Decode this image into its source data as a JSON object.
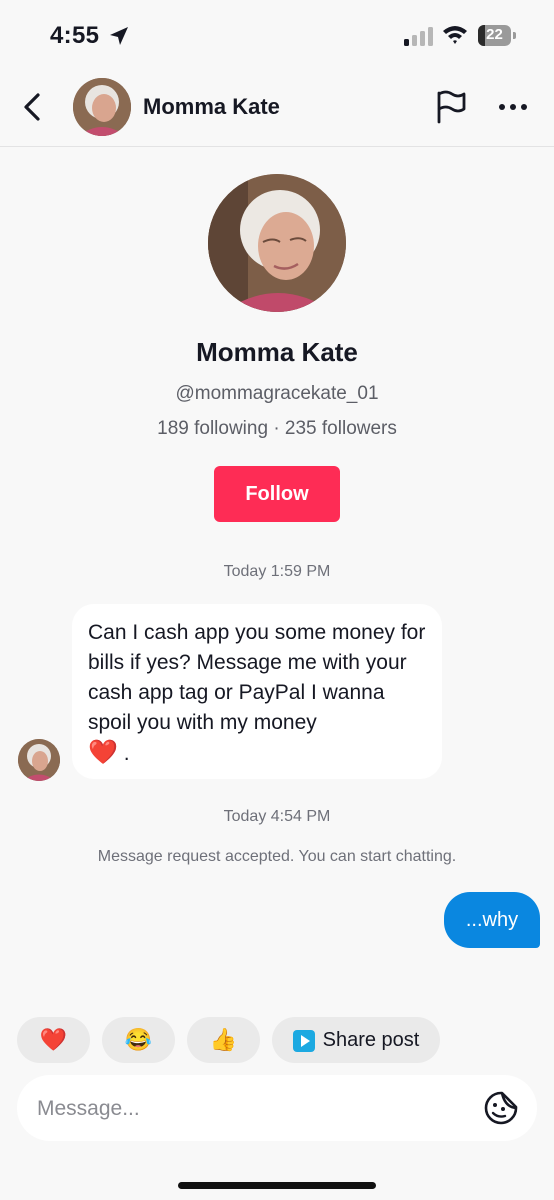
{
  "status_bar": {
    "time": "4:55",
    "battery": "22",
    "battery_fraction": 0.22
  },
  "header": {
    "name": "Momma Kate"
  },
  "profile": {
    "name": "Momma Kate",
    "handle": "@mommagracekate_01",
    "stats": "189 following · 235 followers",
    "follow_label": "Follow"
  },
  "chat": {
    "timestamp_1": "Today 1:59 PM",
    "incoming_message": "Can I cash app you some money for bills if yes? Message me with your cash app tag or PayPal I wanna spoil you with my money",
    "incoming_emoji": "❤️",
    "incoming_tail": ".",
    "timestamp_2": "Today 4:54 PM",
    "system_note": "Message request accepted. You can start chatting.",
    "outgoing_message": "...why"
  },
  "quick_replies": {
    "heart": "❤️",
    "laugh": "😂",
    "thumbs": "👍",
    "share_label": "Share post"
  },
  "composer": {
    "placeholder": "Message..."
  },
  "colors": {
    "accent": "#fe2c55",
    "outgoing_bubble": "#0a87e0",
    "background": "#f8f8f8"
  }
}
